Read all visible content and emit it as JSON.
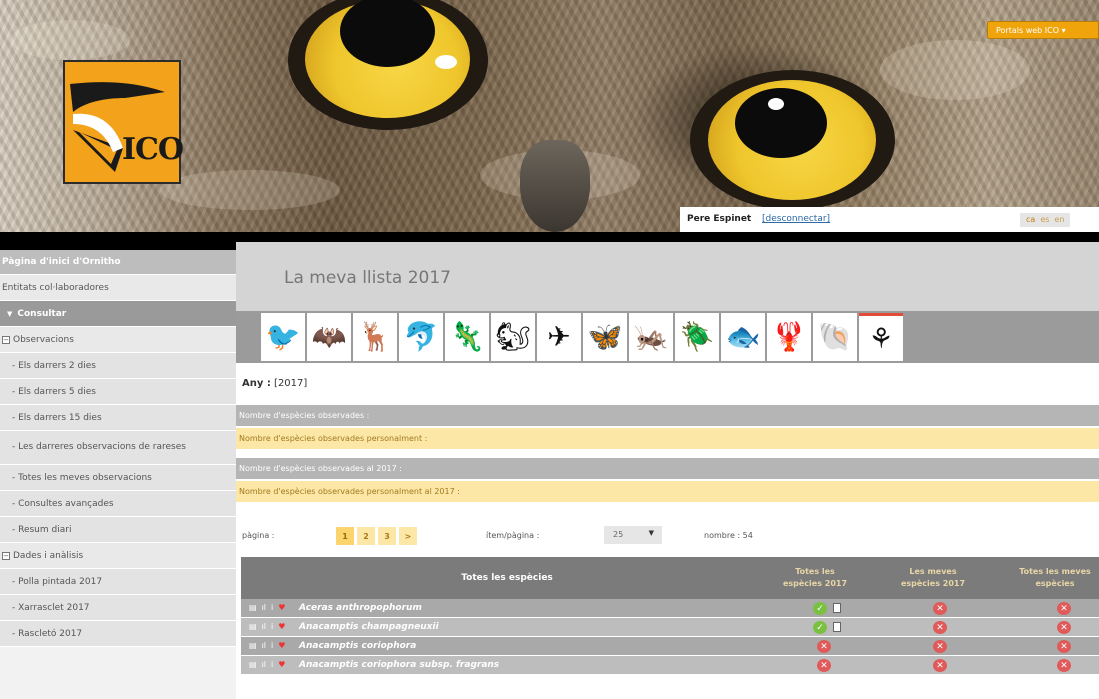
{
  "header": {
    "portals_label": "Portals web ICO ▾",
    "logo_text": "ICO",
    "user_name": "Pere Espinet",
    "logout_label": "[desconnectar]",
    "languages": [
      "ca",
      "es",
      "en"
    ]
  },
  "sidebar": {
    "home": "Pàgina d'inici d'Ornitho",
    "entities": "Entitats col·laboradores",
    "section": "Consultar",
    "group_obs": "Observacions",
    "obs_items": [
      "- Els darrers 2 dies",
      "- Els darrers 5 dies",
      "- Els darrers 15 dies",
      "- Les darreres observacions de rareses",
      "- Totes les meves observacions",
      "- Consultes avançades",
      "- Resum diari"
    ],
    "group_data": "Dades i anàlisis",
    "data_items": [
      "- Polla pintada 2017",
      "- Xarrasclet 2017",
      "- Rascletó 2017"
    ]
  },
  "main": {
    "title": "La meva llista 2017",
    "tabs": [
      "bird-icon",
      "bat-icon",
      "deer-icon",
      "dolphin-icon",
      "lizard-icon",
      "squirrel-icon",
      "dragonfly-icon",
      "butterfly-icon",
      "grasshopper-icon",
      "beetle-icon",
      "fish-icon",
      "crayfish-icon",
      "shell-icon",
      "orchid-icon"
    ],
    "any_label": "Any :",
    "any_value": "[2017]",
    "stats": [
      "Nombre d'espècies observades :",
      "Nombre d'espècies observades personalment :",
      "Nombre d'espècies observades al 2017 :",
      "Nombre d'espècies observades personalment al 2017 :"
    ],
    "pager": {
      "page_label": "pàgina :",
      "pages": [
        "1",
        "2",
        "3",
        ">"
      ],
      "per_page_label": "ítem/pàgina :",
      "per_page_value": "25",
      "count_label": "nombre : 54"
    },
    "table": {
      "headers": [
        "Totes les espècies",
        "Totes les espècies 2017",
        "Les meves espècies 2017",
        "Totes les meves espècies"
      ],
      "rows": [
        {
          "name": "Aceras anthropophorum",
          "all2017": "yes",
          "mine2017": "no",
          "mine": "no"
        },
        {
          "name": "Anacamptis champagneuxii",
          "all2017": "yes",
          "mine2017": "no",
          "mine": "no"
        },
        {
          "name": "Anacamptis coriophora",
          "all2017": "no",
          "mine2017": "no",
          "mine": "no"
        },
        {
          "name": "Anacamptis coriophora subsp. fragrans",
          "all2017": "no",
          "mine2017": "no",
          "mine": "no"
        }
      ]
    }
  }
}
